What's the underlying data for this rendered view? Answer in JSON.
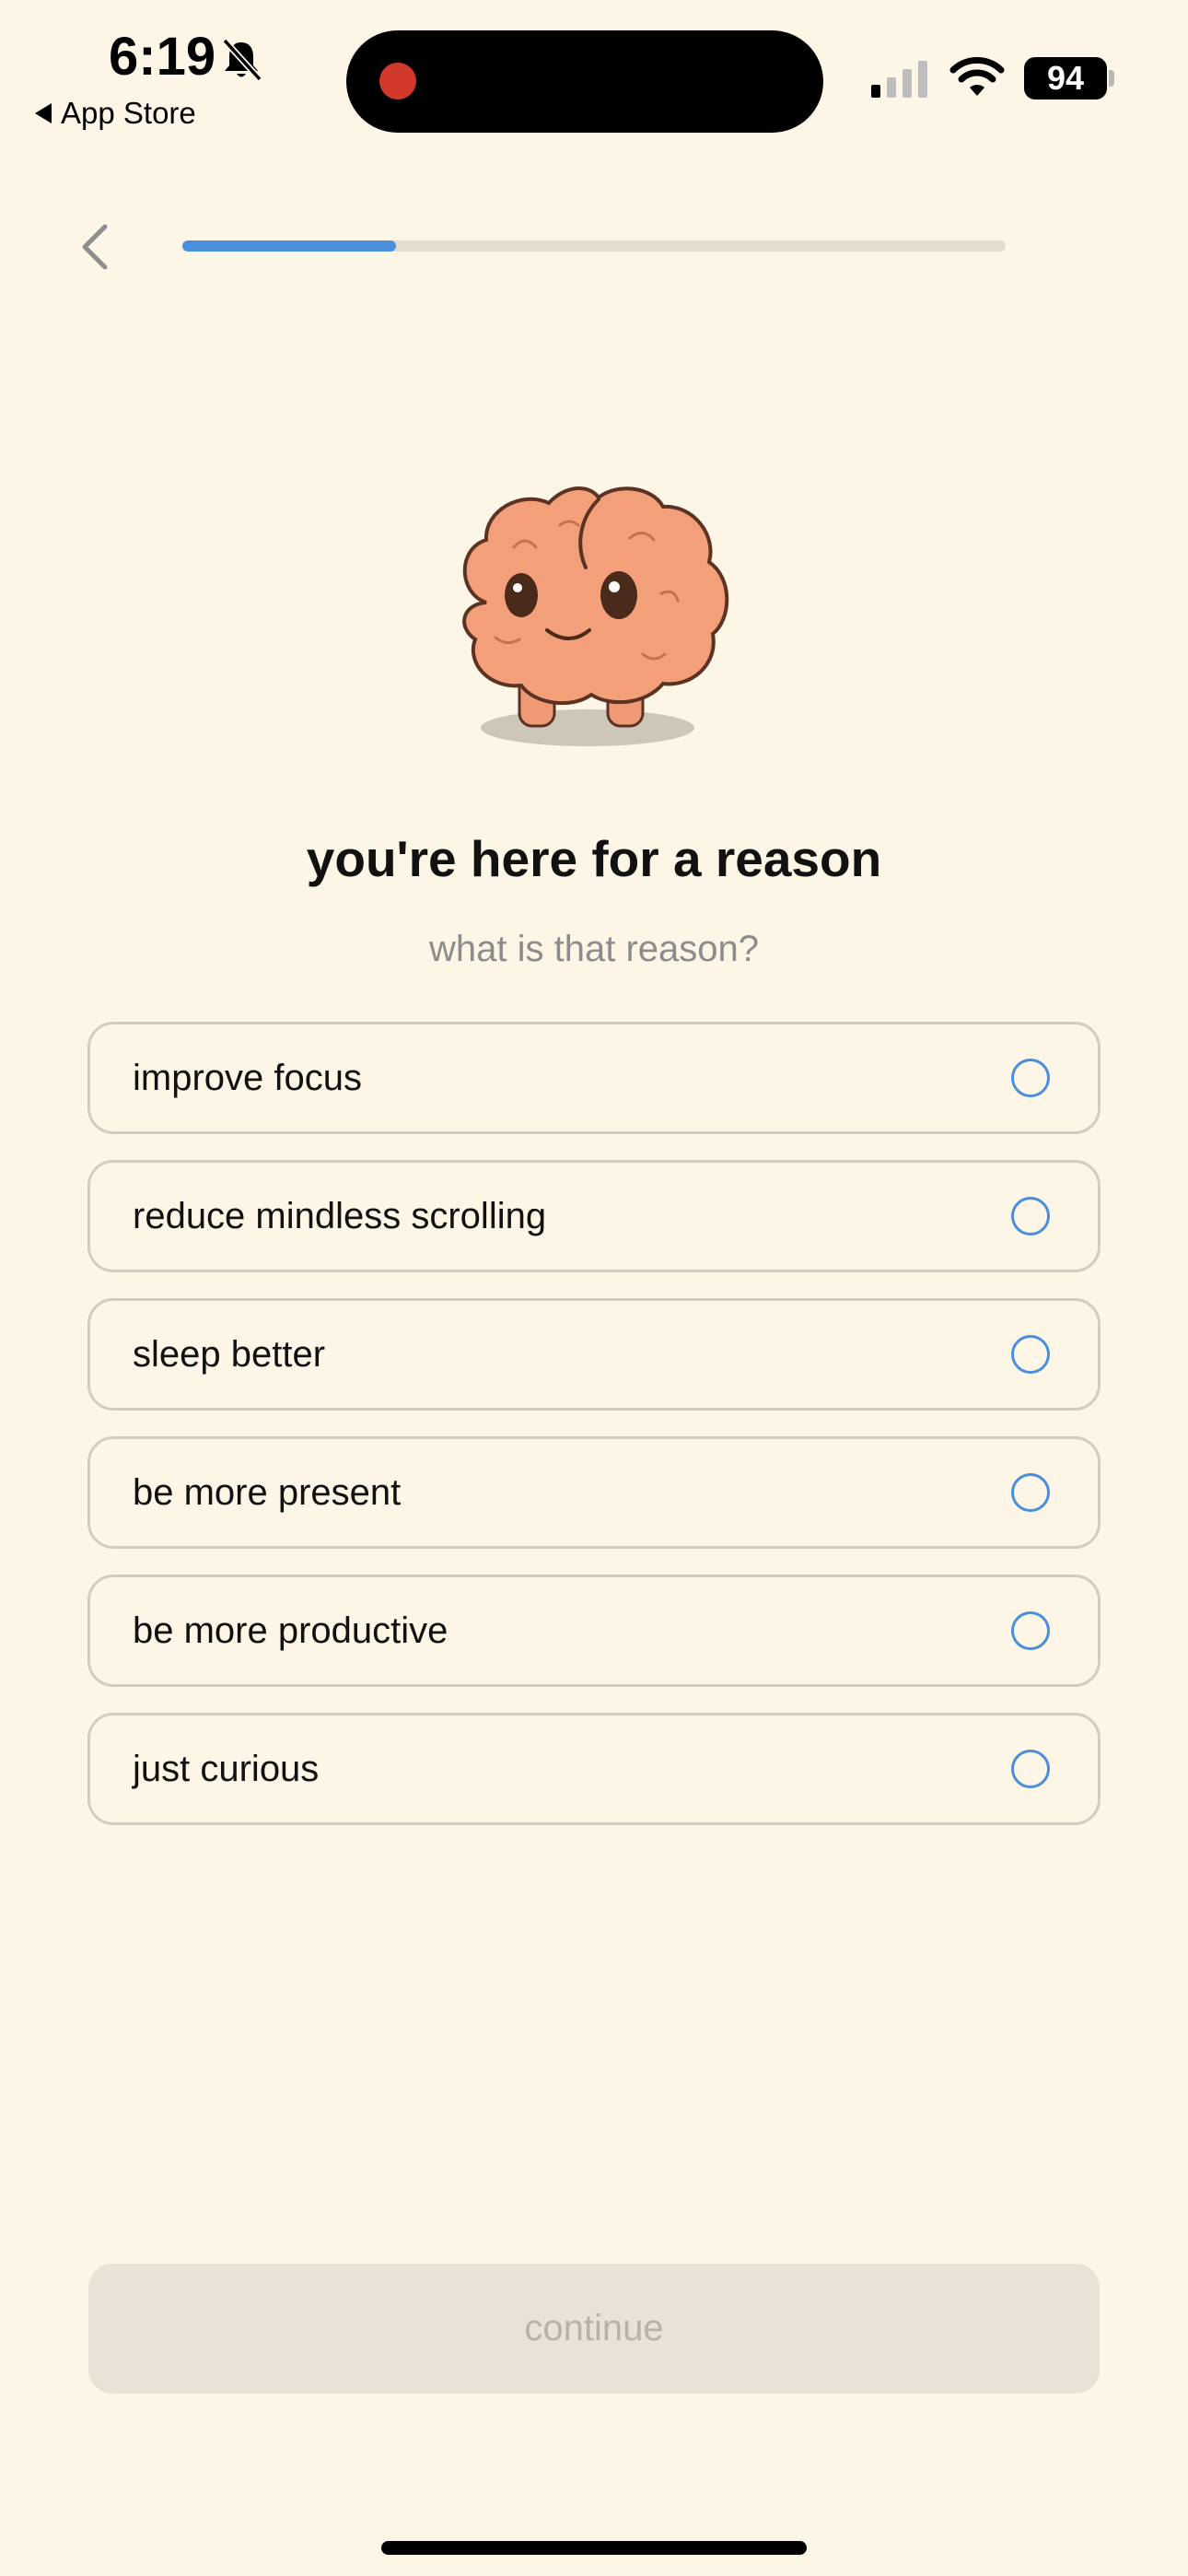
{
  "status_bar": {
    "time": "6:19",
    "back_app_label": "App Store",
    "battery_level": "94",
    "icons": [
      "bell-slash-icon",
      "signal-icon",
      "wifi-icon",
      "battery-icon"
    ],
    "recording_dot_color": "#D2392B"
  },
  "onboarding": {
    "progress_fraction": 0.26,
    "progress_color": "#4A8FDC",
    "title": "you're here for a reason",
    "subtitle": "what is that reason?",
    "options": [
      {
        "label": "improve focus",
        "selected": false
      },
      {
        "label": "reduce mindless scrolling",
        "selected": false
      },
      {
        "label": "sleep better",
        "selected": false
      },
      {
        "label": "be more present",
        "selected": false
      },
      {
        "label": "be more productive",
        "selected": false
      },
      {
        "label": "just curious",
        "selected": false
      }
    ],
    "continue_label": "continue",
    "continue_enabled": false
  },
  "colors": {
    "background": "#FDF6E6",
    "accent": "#4A8FDC",
    "mascot_fill": "#F3A07A"
  }
}
